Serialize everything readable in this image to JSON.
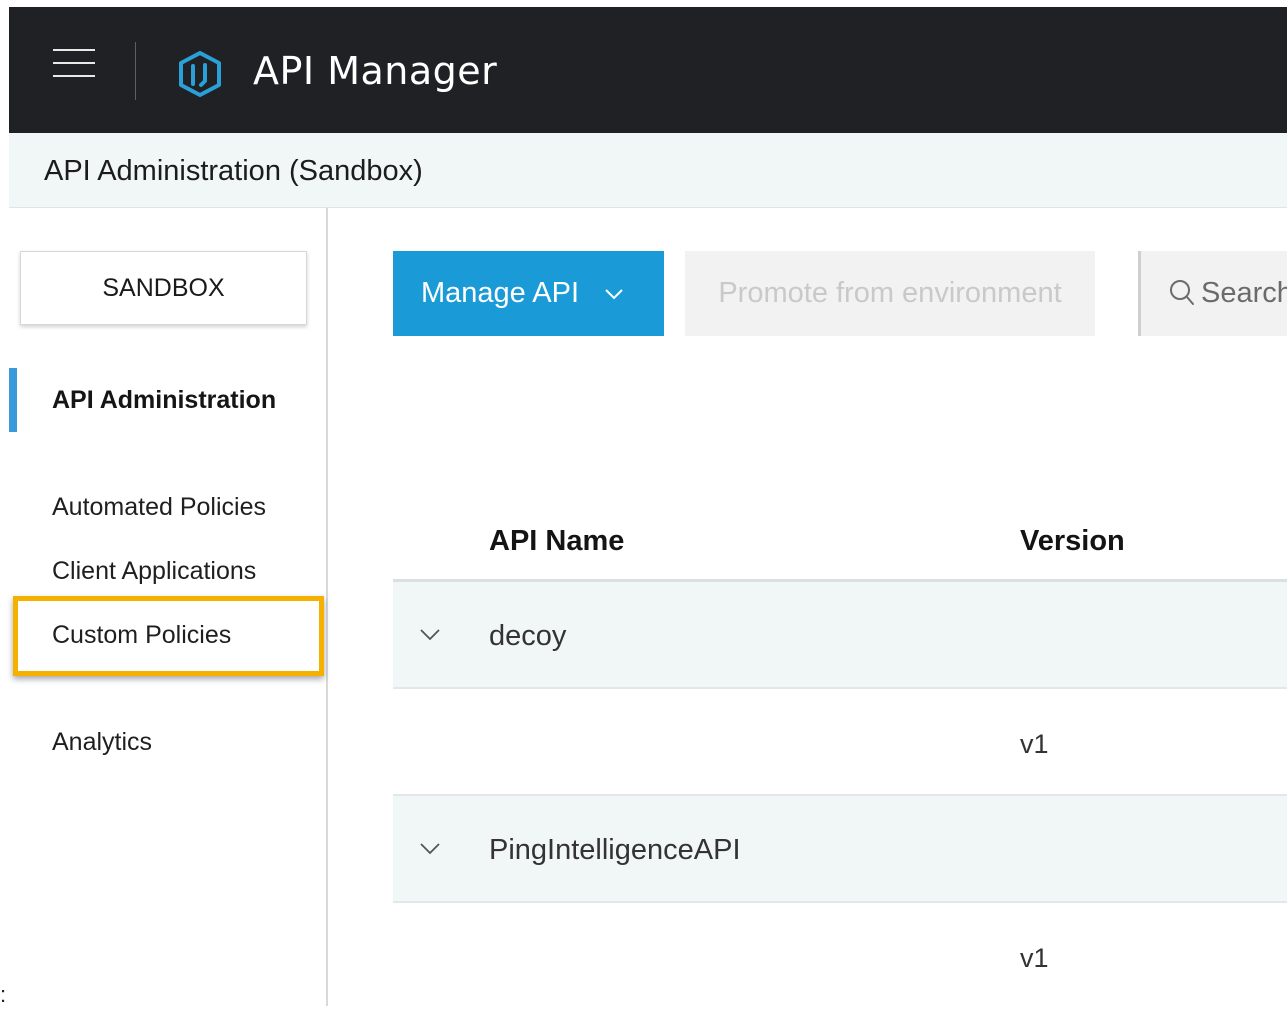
{
  "header": {
    "app_title": "API Manager",
    "menu_icon": "hamburger-menu-icon",
    "logo_icon": "api-manager-logo-icon"
  },
  "subheader": {
    "title": "API Administration (Sandbox)"
  },
  "sidebar": {
    "environment_button": "SANDBOX",
    "items": [
      {
        "label": "API Administration",
        "active": true
      },
      {
        "label": "Automated Policies",
        "active": false
      },
      {
        "label": "Client Applications",
        "active": false
      },
      {
        "label": "Custom Policies",
        "active": false,
        "highlighted": true
      },
      {
        "label": "Analytics",
        "active": false
      }
    ]
  },
  "toolbar": {
    "manage_api_label": "Manage API",
    "promote_label": "Promote from environment",
    "search_placeholder": "Search"
  },
  "table": {
    "columns": [
      "API Name",
      "Version"
    ],
    "rows": [
      {
        "type": "group",
        "api_name": "decoy",
        "version": ""
      },
      {
        "type": "version",
        "api_name": "",
        "version": "v1"
      },
      {
        "type": "group",
        "api_name": "PingIntelligenceAPI",
        "version": ""
      },
      {
        "type": "version",
        "api_name": "",
        "version": "v1"
      }
    ]
  },
  "colors": {
    "header_bg": "#202124",
    "accent": "#1a9bd7",
    "highlight": "#f4b100",
    "group_row_bg": "#f1f6f6"
  },
  "stray": ":"
}
